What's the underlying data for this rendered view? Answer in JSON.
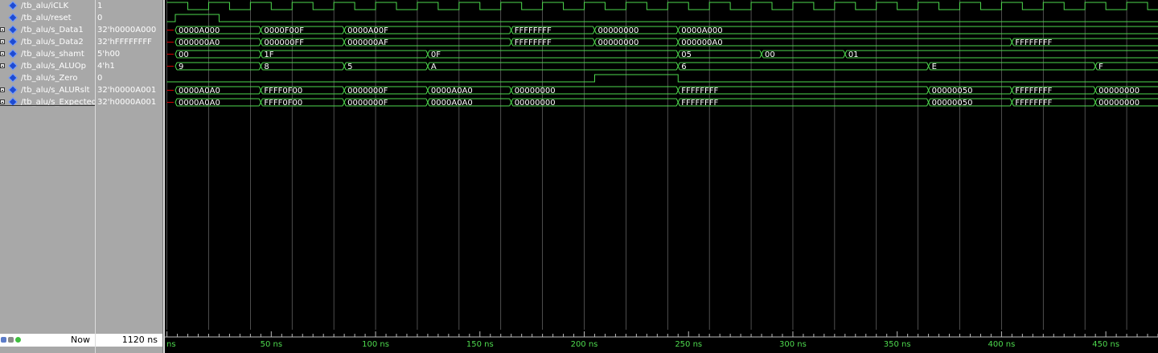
{
  "signals": [
    {
      "name": "/tb_alu/iCLK",
      "value": "1",
      "expandable": false
    },
    {
      "name": "/tb_alu/reset",
      "value": "0",
      "expandable": false
    },
    {
      "name": "/tb_alu/s_Data1",
      "value": "32'h0000A000",
      "expandable": true
    },
    {
      "name": "/tb_alu/s_Data2",
      "value": "32'hFFFFFFFF",
      "expandable": true
    },
    {
      "name": "/tb_alu/s_shamt",
      "value": "5'h00",
      "expandable": true
    },
    {
      "name": "/tb_alu/s_ALUOp",
      "value": "4'h1",
      "expandable": true
    },
    {
      "name": "/tb_alu/s_Zero",
      "value": "0",
      "expandable": false
    },
    {
      "name": "/tb_alu/s_ALURslt",
      "value": "32'h0000A001",
      "expandable": true
    },
    {
      "name": "/tb_alu/s_Expected",
      "value": "32'h0000A001",
      "expandable": true
    }
  ],
  "now": {
    "label": "Now",
    "value": "1120 ns"
  },
  "timeline": {
    "unit": "ns",
    "range": [
      -1,
      475
    ],
    "first_label": "ns",
    "ticks": [
      {
        "t": 50,
        "label": "50 ns"
      },
      {
        "t": 100,
        "label": "100 ns"
      },
      {
        "t": 150,
        "label": "150 ns"
      },
      {
        "t": 200,
        "label": "200 ns"
      },
      {
        "t": 250,
        "label": "250 ns"
      },
      {
        "t": 300,
        "label": "300 ns"
      },
      {
        "t": 350,
        "label": "350 ns"
      },
      {
        "t": 400,
        "label": "400 ns"
      },
      {
        "t": 450,
        "label": "450 ns"
      }
    ]
  },
  "clock": {
    "period_ns": 20,
    "high_first_ns": 10
  },
  "reset": {
    "high_from_ns": 4,
    "high_to_ns": 25
  },
  "buses": {
    "s_Data1": [
      [
        4,
        "0000A000"
      ],
      [
        45,
        "0000F00F"
      ],
      [
        85,
        "0000A00F"
      ],
      [
        165,
        "FFFFFFFF"
      ],
      [
        205,
        "00000000"
      ],
      [
        245,
        "0000A000"
      ]
    ],
    "s_Data2": [
      [
        4,
        "000000A0"
      ],
      [
        45,
        "000000FF"
      ],
      [
        85,
        "000000AF"
      ],
      [
        165,
        "FFFFFFFF"
      ],
      [
        205,
        "00000000"
      ],
      [
        245,
        "000000A0"
      ],
      [
        405,
        "FFFFFFFF"
      ]
    ],
    "s_shamt": [
      [
        4,
        "00"
      ],
      [
        45,
        "1F"
      ],
      [
        125,
        "0F"
      ],
      [
        245,
        "05"
      ],
      [
        285,
        "00"
      ],
      [
        325,
        "01"
      ]
    ],
    "s_ALUOp": [
      [
        4,
        "9"
      ],
      [
        45,
        "8"
      ],
      [
        85,
        "5"
      ],
      [
        125,
        "A"
      ],
      [
        245,
        "6"
      ],
      [
        365,
        "E"
      ],
      [
        445,
        "F"
      ]
    ],
    "s_ALURslt": [
      [
        4,
        "0000A0A0"
      ],
      [
        45,
        "FFFF0F00"
      ],
      [
        85,
        "0000000F"
      ],
      [
        125,
        "0000A0A0"
      ],
      [
        165,
        "00000000"
      ],
      [
        245,
        "FFFFFFFF"
      ],
      [
        365,
        "00000050"
      ],
      [
        405,
        "FFFFFFFF"
      ],
      [
        445,
        "00000000"
      ]
    ],
    "s_Expected": [
      [
        4,
        "0000A0A0"
      ],
      [
        45,
        "FFFF0F00"
      ],
      [
        85,
        "0000000F"
      ],
      [
        125,
        "0000A0A0"
      ],
      [
        165,
        "00000000"
      ],
      [
        245,
        "FFFFFFFF"
      ],
      [
        365,
        "00000050"
      ],
      [
        405,
        "FFFFFFFF"
      ],
      [
        445,
        "00000000"
      ]
    ]
  },
  "zero": {
    "high_from_ns": 205,
    "high_to_ns": 245
  },
  "colors": {
    "wave": "#4ed94e",
    "grid": "#6e6e6e",
    "background": "#000000",
    "unknown": "#d40000"
  }
}
